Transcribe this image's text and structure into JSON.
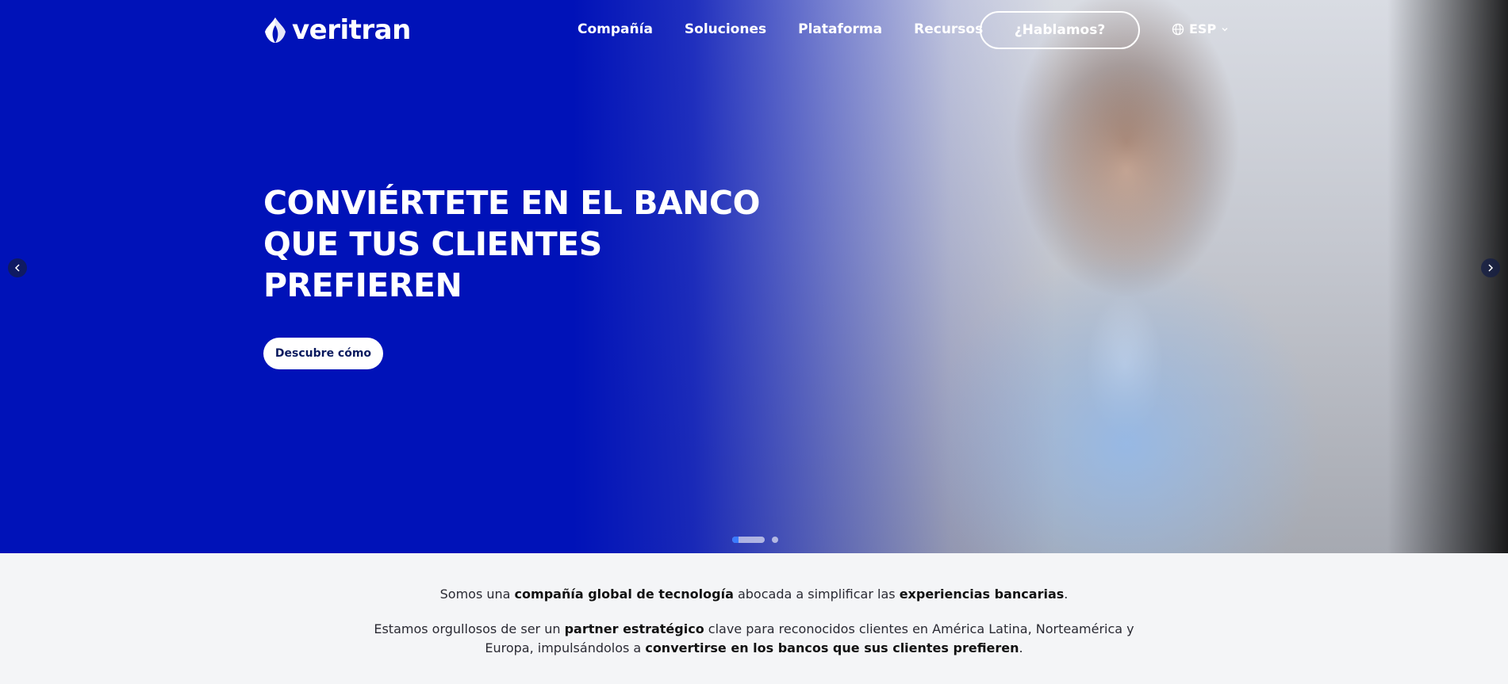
{
  "nav": {
    "logo_text": "veritran",
    "links": [
      {
        "label": "Compañía"
      },
      {
        "label": "Soluciones"
      },
      {
        "label": "Plataforma"
      },
      {
        "label": "Recursos"
      }
    ],
    "cta_label": "¿Hablamos?",
    "language": "ESP",
    "icons": {
      "language": "globe-icon",
      "dropdown": "chevron-down-icon"
    }
  },
  "hero": {
    "headline_lines": [
      "CONVIÉRTETE EN EL BANCO",
      "QUE TUS CLIENTES",
      "PREFIEREN"
    ],
    "button_label": "Descubre cómo",
    "slides_total": 2,
    "active_slide": 1,
    "arrows": {
      "prev": "chevron-left-icon",
      "next": "chevron-right-icon"
    }
  },
  "intro": {
    "p1": {
      "a": "Somos una ",
      "b": "compañía global de tecnología",
      "c": " abocada a simplificar las ",
      "d": "experiencias bancarias",
      "e": "."
    },
    "p2": {
      "a": "Estamos orgullosos de ser un ",
      "b": "partner estratégico",
      "c": " clave para reconocidos clientes en América Latina, Norteamérica y",
      "d": "Europa, impulsándolos a ",
      "e": "convertirse en los bancos que sus clientes prefieren",
      "f": "."
    }
  },
  "colors": {
    "brand_blue": "#0012b8",
    "white": "#ffffff",
    "text_dark": "#2a2a33",
    "button_text": "#0a1a5e",
    "section_bg": "#f4f5f7"
  }
}
